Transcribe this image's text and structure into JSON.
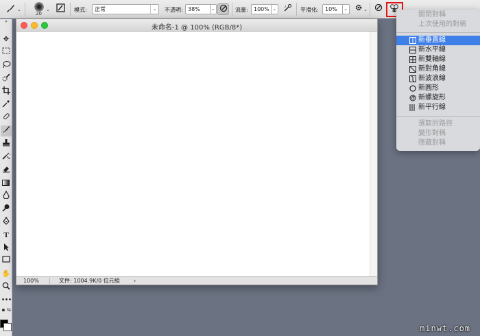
{
  "options_bar": {
    "brush_size": "20",
    "mode_label": "模式:",
    "mode_value": "正常",
    "opacity_label": "不透明:",
    "opacity_value": "38%",
    "flow_label": "流量:",
    "flow_value": "100%",
    "smoothing_label": "平滑化:",
    "smoothing_value": "10%"
  },
  "document": {
    "title": "未命名-1 @ 100% (RGB/8*)",
    "zoom": "100%",
    "file_info": "文件: 1004.9K/0 位元組"
  },
  "symmetry_menu": {
    "items": [
      {
        "label": "關閉對稱",
        "icon": "",
        "enabled": false
      },
      {
        "label": "上次使用的對稱",
        "icon": "",
        "enabled": false
      },
      {
        "label": "新垂直線",
        "icon": "vertical-line-icon",
        "enabled": true,
        "highlighted": true
      },
      {
        "label": "新水平線",
        "icon": "horizontal-line-icon",
        "enabled": true
      },
      {
        "label": "新雙軸線",
        "icon": "dual-axis-icon",
        "enabled": true
      },
      {
        "label": "新對角線",
        "icon": "diagonal-icon",
        "enabled": true
      },
      {
        "label": "新波浪線",
        "icon": "wavy-line-icon",
        "enabled": true
      },
      {
        "label": "新圓形",
        "icon": "circle-icon",
        "enabled": true
      },
      {
        "label": "新螺旋形",
        "icon": "spiral-icon",
        "enabled": true
      },
      {
        "label": "新平行線",
        "icon": "parallel-lines-icon",
        "enabled": true
      },
      {
        "label": "選取的路徑",
        "icon": "",
        "enabled": false
      },
      {
        "label": "變形對稱",
        "icon": "",
        "enabled": false
      },
      {
        "label": "隱藏對稱",
        "icon": "",
        "enabled": false
      }
    ]
  },
  "colors": {
    "menu_highlight": "#3f7fe8",
    "callout_border": "#e41414",
    "workspace_bg": "#6b7282"
  },
  "watermark": "minwt.com"
}
